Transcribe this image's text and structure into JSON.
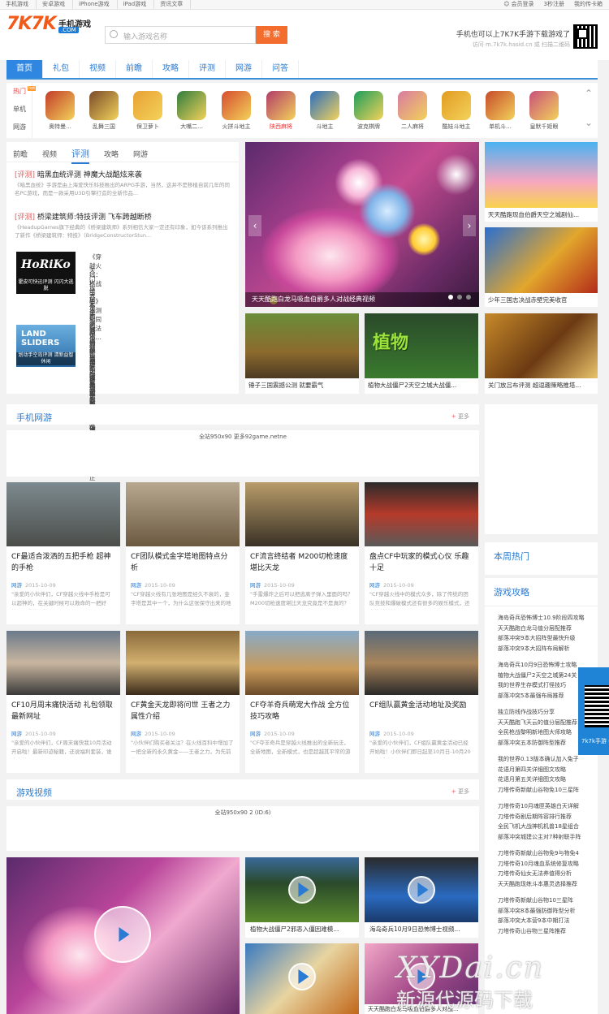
{
  "topbar": {
    "links": [
      "手机游戏",
      "安卓游戏",
      "iPhone游戏",
      "iPad游戏",
      "资讯文章"
    ],
    "right": [
      "会员登录",
      "3秒注册",
      "我的传卡箱"
    ]
  },
  "header": {
    "logo_text": "7K7K",
    "logo_sub": "手机游戏",
    "logo_com": ".COM",
    "search_placeholder": "输入游戏名称",
    "search_button": "搜 索",
    "hint_line1": "手机也可以上7K7K手游下载游戏了",
    "hint_line2": "访问 m.7k7k.hasid.cn 或 扫描二维码"
  },
  "nav": [
    "首页",
    "礼包",
    "视频",
    "前瞻",
    "攻略",
    "评测",
    "网游",
    "问答"
  ],
  "hot": {
    "side": [
      "热门",
      "单机",
      "网游"
    ],
    "badge": "hot",
    "games": [
      {
        "name": "奥特曼...",
        "color": "#c23c2a"
      },
      {
        "name": "乱舞三国",
        "color": "#7a4a2a"
      },
      {
        "name": "保卫萝卜",
        "color": "#e8a035"
      },
      {
        "name": "大嘴二...",
        "color": "#2f7d3e"
      },
      {
        "name": "火拼斗地主",
        "color": "#d64c2e"
      },
      {
        "name": "陕西麻将",
        "color": "#b23b6a"
      },
      {
        "name": "斗地主",
        "color": "#2a6ec0"
      },
      {
        "name": "波克棋牌",
        "color": "#1b9e5a"
      },
      {
        "name": "二人麻将",
        "color": "#d87aa2"
      },
      {
        "name": "酷娃斗地主",
        "color": "#e29b23"
      },
      {
        "name": "单机斗...",
        "color": "#c64a2a"
      },
      {
        "name": "皇默千姬眼",
        "color": "#c8507a"
      }
    ]
  },
  "left": {
    "tabs": [
      "前瞻",
      "视频",
      "评测",
      "攻略",
      "网游"
    ],
    "articles": [
      {
        "tag": "[评测]",
        "title": "暗黑血统评测 神魔大战酷炫来袭",
        "desc": "《暗黑血统》手游是由上海爱快乐科技推出的ARPG手游，当然，这并不是移植自前几年的同名PC游戏，而是一款采用U3D引擎打造的全新作品..."
      },
      {
        "tag": "[评测]",
        "title": "桥梁建筑师:特技评测 飞车跨越断桥",
        "desc": "《HeadupGames旗下经典的《桥梁建筑师》系列相信大家一定还有印象，如今该系列推出了新作《桥梁建筑师：特技》（BridgeConstructorStun..."
      }
    ],
    "thumbA_caption": "霍皮可快迅评测 闪闪大逃脱",
    "thumbB_caption": "划动手空岛评测 清新益智休闲",
    "listA": [
      "《穿越火线：枪战王者》评测 相同玩法不...",
      "关门放吕布评测 超逗趣策略推塔手游来袭",
      "火线精英手游评测 经典射击完美呈现",
      "天天长手游评测 真三国手游无双之作",
      "生肉的山姆评测 手速决定生死"
    ],
    "listB": [
      "洞穴秋千评测 采摘钻石需谨慎",
      "真实拳击2评测 拳皇非你莫属",
      "口袋小队评测 呆萌小兵要逆袭",
      "法术石评测 出牌套路很重要",
      "穿越火线:枪战王者评测 CF正版手游来袭"
    ]
  },
  "banner": {
    "caption": "天天酷跑白龙马吸血伯爵多人对战经典视频",
    "prev": "‹",
    "next": "›"
  },
  "mid_cards": [
    {
      "title": "锤子三国震撼公测 就要霸气"
    },
    {
      "title": "植物大战僵尸2天空之城大战僵..."
    }
  ],
  "right_cards": [
    {
      "title": "天天酷跑现血伯爵天空之城剧仙..."
    },
    {
      "title": "少年三国志决战赤壁完美收官"
    },
    {
      "title": "关门放吕布评测 超逗趣策略推塔..."
    }
  ],
  "section_mobile": {
    "title": "手机网游",
    "more": "更多",
    "ad": "全站950x90 更多92game.netne"
  },
  "news": [
    {
      "title": "CF最适合泼洒的五把手枪 超神的手枪",
      "tag": "网游",
      "date": "2015-10-09",
      "desc": "\"亲爱的小伙伴们，CF穿越火线中手枪是可以超神的，在关键时候可以救命的一把好枪，是非常要的..."
    },
    {
      "title": "CF团队模式金字塔地图特点分析",
      "tag": "网游",
      "date": "2015-10-09",
      "desc": "\"CF穿越火线有几张地图是经久不衰的，金字塔是其中一个，为什么这张保守出来的地图到现在依然..."
    },
    {
      "title": "CF流言终结者 M200切枪速度堪比天龙",
      "tag": "网游",
      "date": "2015-10-09",
      "desc": "\"手雷爆炸之后可以把逃离子弹入里面的吗？M200切枪速度堪比天龙究竟是不是真的？流言到底被..."
    },
    {
      "title": "盘点CF中玩家的模式心仪 乐趣十足",
      "tag": "网游",
      "date": "2015-10-09",
      "desc": "\"CF穿越火线中的模式众多，除了传统的团队竞技和爆破模式还有很多的娱乐模式，还有尚前挑战..."
    },
    {
      "title": "CF10月周末痛快活动 礼包领取最新网址",
      "tag": "网游",
      "date": "2015-10-09",
      "desc": "\"亲爱的小伙伴们，CF周末痛快我10月活动开启啦！最新印迹秘籍，还说福利套装，谁击套装..."
    },
    {
      "title": "CF黄金天龙即将问世 王者之力属性介绍",
      "tag": "网游",
      "date": "2015-10-09",
      "desc": "\"小伙伴们购买者关注？在火线百科中增加了一把全新的永久黄金——王者之力，为先前的王者之..."
    },
    {
      "title": "CF夺羊奇兵萌宠大作战 全方位技巧攻略",
      "tag": "网游",
      "date": "2015-10-09",
      "desc": "\"CF夺羊奇兵是穿越火线推出的全新玩法，全新地图，全新模式，也是超越其平常的游戏。在个人..."
    },
    {
      "title": "CF组队赢黄金活动地址及奖励",
      "tag": "网游",
      "date": "2015-10-09",
      "desc": "\"亲爱的小伙伴们，CF组队赢黄金活动已经开始啦！小伙伴们即日起至10月日-10月20日在活动期间..."
    }
  ],
  "week_hot": {
    "title": "本周热门"
  },
  "guides": {
    "title": "游戏攻略",
    "groups": [
      [
        "海岛奇兵恐怖博士10.9阶段四攻略",
        "天天酷跑白龙马值分层配推荐",
        "部落冲突9本大招阵型最快升级",
        "部落冲突9本大招阵布局解析"
      ],
      [
        "海岛奇兵10月9日恐怖博士攻略",
        "植物大战僵尸2天空之城第24关",
        "我的世界生存模式打怪技巧",
        "部落冲突5本最强布局推荐"
      ],
      [
        "独立防线作战技巧分享",
        "天天酷跑飞天云的值分层配推荐",
        "全民枪战黎明新地图大师攻略",
        "部落冲突五本防御阵型推荐"
      ],
      [
        "我的世界0.13版本确认加入兔子",
        "花语月第四关详细图文攻略",
        "花语月第五关详细图文攻略",
        "刀塔传奇新献山谷物免10三星阵"
      ],
      [
        "刀塔传奇10月魂匣英雄白天详解",
        "刀塔传奇剧后期阵容排行推荐",
        "全民飞机大战神机机兽18星组合",
        "部落冲突城建公主对7种射联手阵"
      ],
      [
        "刀塔传奇新献山谷物免9与物免4",
        "刀塔传奇10月魂血系统修复攻略",
        "刀塔传奇仙女无法养值得分析",
        "天天酷跑现练斗本惠灵选择推荐"
      ],
      [
        "刀塔传奇新献山谷物10三星阵",
        "部落冲突8本最强防御阵型分析",
        "部落冲突大本营9本中期打法",
        "刀塔传奇山谷物三星阵推荐"
      ]
    ]
  },
  "side_qr": {
    "label": "7k7k手游 扫码获取"
  },
  "section_video": {
    "title": "游戏视频",
    "more": "更多",
    "ad": "全站950x90 2 (ID:6)"
  },
  "videos": [
    {
      "title": "植物大战僵尸2邪恶入僵因难模..."
    },
    {
      "title": "海岛奇兵10月9日恐怖博士视频..."
    },
    {
      "title": "天天酷跑白龙马吸血伯爵多人对战..."
    }
  ],
  "watermark": {
    "line1": "XYDai.cn",
    "line2": "新源代源码下载"
  }
}
